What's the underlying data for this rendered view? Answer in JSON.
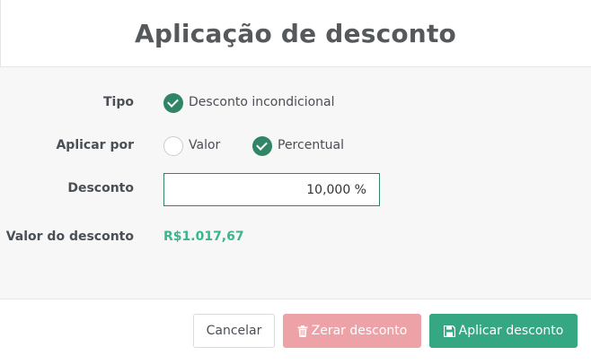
{
  "dialog": {
    "title": "Aplicação de desconto"
  },
  "form": {
    "tipo": {
      "label": "Tipo",
      "option_label": "Desconto incondicional",
      "checked": true
    },
    "aplicar_por": {
      "label": "Aplicar por",
      "options": [
        {
          "label": "Valor",
          "checked": false
        },
        {
          "label": "Percentual",
          "checked": true
        }
      ]
    },
    "desconto": {
      "label": "Desconto",
      "value": "10,000 %"
    },
    "valor_do_desconto": {
      "label": "Valor do desconto",
      "value": "R$1.017,67"
    }
  },
  "footer": {
    "cancel_label": "Cancelar",
    "reset_label": "Zerar desconto",
    "apply_label": "Aplicar desconto"
  },
  "icons": {
    "reset": "trash-icon",
    "apply": "save-icon"
  },
  "colors": {
    "primary": "#2f8566",
    "apply_button": "#36a783",
    "reset_button": "#eda2a7",
    "discount_amount": "#3bb58b"
  }
}
